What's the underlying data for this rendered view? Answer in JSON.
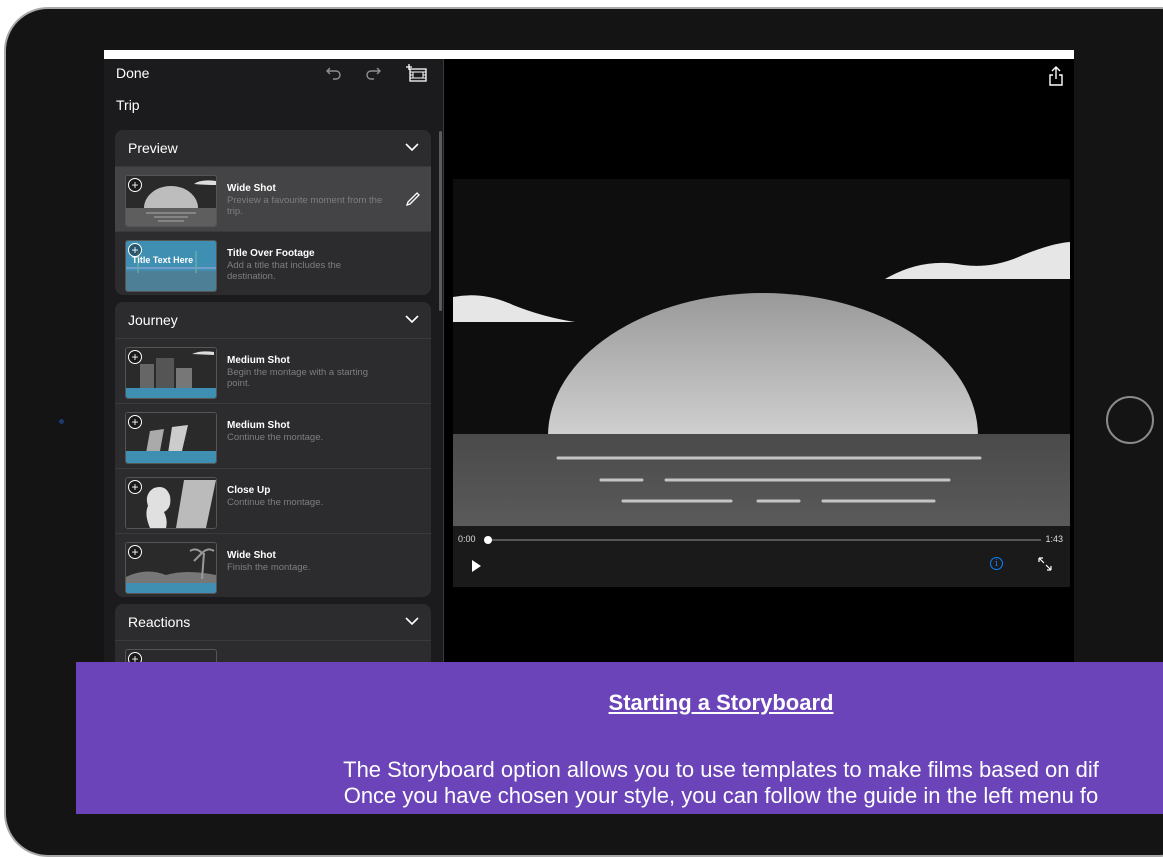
{
  "toolbar": {
    "done_label": "Done",
    "project_name": "Trip"
  },
  "sections": [
    {
      "title": "Preview",
      "items": [
        {
          "title": "Wide Shot",
          "desc": "Preview a favourite moment from the trip.",
          "selected": true
        },
        {
          "title": "Title Over Footage",
          "desc": "Add a title that includes the destination.",
          "thumb_text": "Title Text Here"
        }
      ]
    },
    {
      "title": "Journey",
      "items": [
        {
          "title": "Medium Shot",
          "desc": "Begin the montage with a starting point."
        },
        {
          "title": "Medium Shot",
          "desc": "Continue the montage."
        },
        {
          "title": "Close Up",
          "desc": "Continue the montage."
        },
        {
          "title": "Wide Shot",
          "desc": "Finish the montage."
        }
      ]
    },
    {
      "title": "Reactions",
      "items": []
    }
  ],
  "player": {
    "time_current": "0:00",
    "time_total": "1:43",
    "progress": 0.0
  },
  "banner": {
    "title": "Starting a Storyboard",
    "line1": "The Storyboard option allows you to use templates to make films based on dif",
    "line2": "Once you have chosen your style, you can follow the guide in the left menu fo"
  },
  "colors": {
    "accent": "#0a84ff",
    "banner": "#6a44b8"
  },
  "icons": [
    "undo-icon",
    "redo-icon",
    "add-clip-icon",
    "share-icon",
    "chevron-down-icon",
    "pencil-icon",
    "play-icon",
    "info-icon",
    "expand-icon",
    "plus-icon"
  ]
}
